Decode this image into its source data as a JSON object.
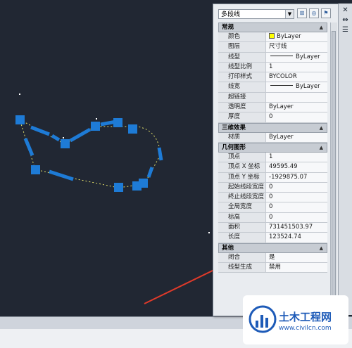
{
  "palette": {
    "object_type": "多段线",
    "sections": [
      {
        "title": "常规",
        "rows": [
          {
            "key": "颜色",
            "value": "ByLayer",
            "swatch": "#ffff00"
          },
          {
            "key": "图层",
            "value": "尺寸线"
          },
          {
            "key": "线型",
            "value": "ByLayer",
            "linestyle": true
          },
          {
            "key": "线型比例",
            "value": "1"
          },
          {
            "key": "打印样式",
            "value": "BYCOLOR"
          },
          {
            "key": "线宽",
            "value": "ByLayer",
            "linestyle": true
          },
          {
            "key": "超链接",
            "value": ""
          },
          {
            "key": "透明度",
            "value": "ByLayer"
          },
          {
            "key": "厚度",
            "value": "0"
          }
        ]
      },
      {
        "title": "三维效果",
        "rows": [
          {
            "key": "材质",
            "value": "ByLayer"
          }
        ]
      },
      {
        "title": "几何图形",
        "rows": [
          {
            "key": "顶点",
            "value": "1"
          },
          {
            "key": "顶点 X 坐标",
            "value": "49595.49"
          },
          {
            "key": "顶点 Y 坐标",
            "value": "-1929875.07"
          },
          {
            "key": "起始线段宽度",
            "value": "0"
          },
          {
            "key": "终止线段宽度",
            "value": "0"
          },
          {
            "key": "全局宽度",
            "value": "0"
          },
          {
            "key": "标高",
            "value": "0"
          },
          {
            "key": "面积",
            "value": "731451503.97"
          },
          {
            "key": "长度",
            "value": "123524.74"
          }
        ]
      },
      {
        "title": "其他",
        "rows": [
          {
            "key": "闭合",
            "value": "是"
          },
          {
            "key": "线型生成",
            "value": "禁用"
          }
        ]
      }
    ]
  },
  "watermark": {
    "title": "土木工程网",
    "url": "www.civilcn.com"
  },
  "colors": {
    "canvas_bg": "#212733",
    "grip_blue": "#1e7bd6",
    "dash_yellow": "#e6e26a",
    "arrow_red": "#e03a2a"
  }
}
